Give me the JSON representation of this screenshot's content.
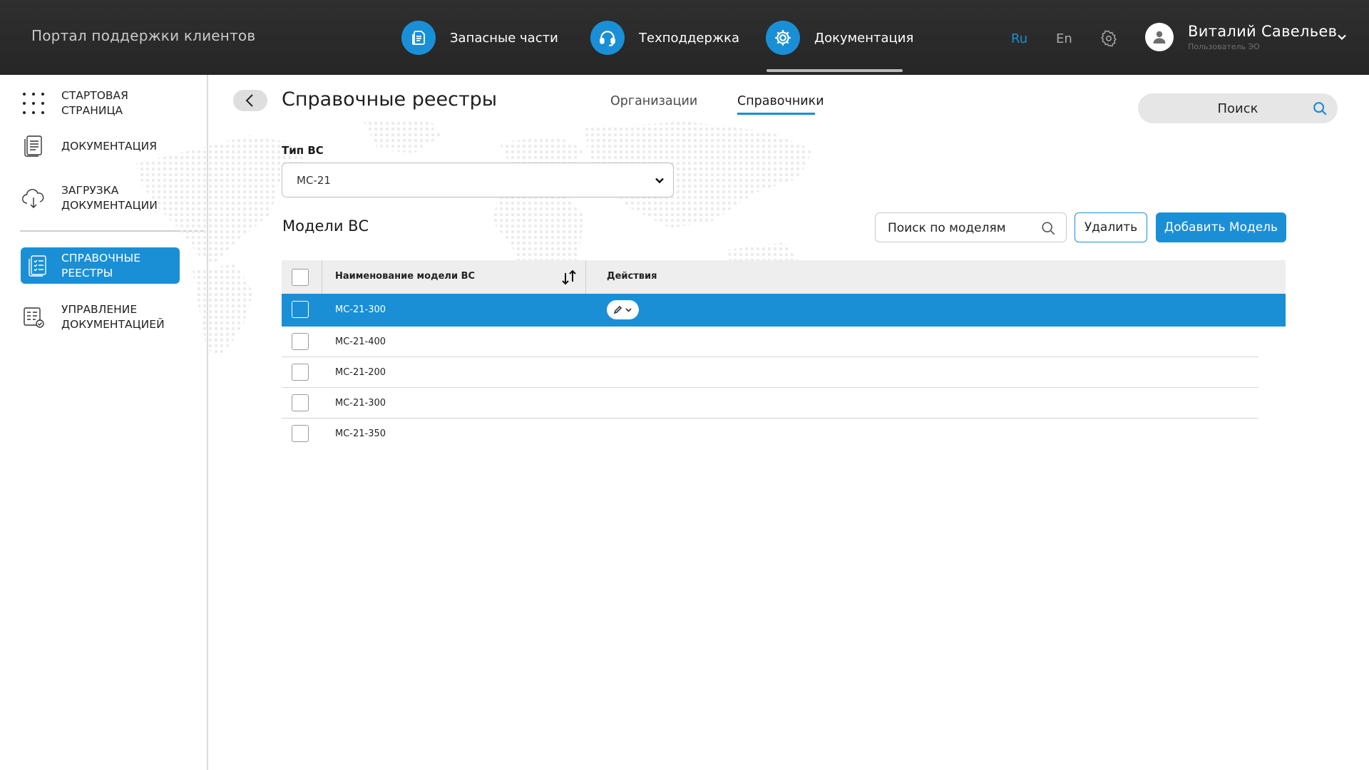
{
  "header": {
    "portal_title": "Портал поддержки клиентов",
    "nav": [
      {
        "label": "Запасные части",
        "icon": "document-icon"
      },
      {
        "label": "Техподдержка",
        "icon": "headset-icon"
      },
      {
        "label": "Документация",
        "icon": "gear-doc-icon",
        "active": true
      }
    ],
    "lang_ru": "Ru",
    "lang_en": "En",
    "user_name": "Виталий Савельев",
    "user_role": "Пользователь ЭО"
  },
  "sidebar": {
    "items": [
      {
        "label": "СТАРТОВАЯ СТРАНИЦА",
        "icon": "grid-dots-icon"
      },
      {
        "label": "ДОКУМЕНТАЦИЯ",
        "icon": "document-icon"
      },
      {
        "label_line1": "ЗАГРУЗКА",
        "label_line2": "ДОКУМЕНТАЦИИ",
        "icon": "cloud-upload-icon"
      },
      {
        "label_line1": "СПРАВОЧНЫЕ",
        "label_line2": "РЕЕСТРЫ",
        "icon": "checklist-icon",
        "active": true
      },
      {
        "label_line1": "УПРАВЛЕНИЕ",
        "label_line2": "ДОКУМЕНТАЦИЕЙ",
        "icon": "manage-docs-icon"
      }
    ]
  },
  "main": {
    "title": "Справочные реестры",
    "tabs": [
      {
        "label": "Организации"
      },
      {
        "label": "Справочники",
        "active": true
      }
    ],
    "global_search_label": "Поиск",
    "type_label": "Тип ВС",
    "type_value": "МС-21",
    "section_title": "Модели ВС",
    "model_search_placeholder": "Поиск по моделям",
    "delete_label": "Удалить",
    "add_label": "Добавить Модель"
  },
  "table": {
    "columns": [
      "Наименование модели ВС",
      "Действия"
    ],
    "rows": [
      {
        "name": "МС-21-300",
        "selected": true
      },
      {
        "name": "МС-21-400"
      },
      {
        "name": "МС-21-200"
      },
      {
        "name": "МС-21-300"
      },
      {
        "name": "МС-21-350"
      }
    ]
  },
  "colors": {
    "accent": "#1a8fd6",
    "topbar": "#2b2b2b",
    "header_row": "#eeeeee"
  }
}
